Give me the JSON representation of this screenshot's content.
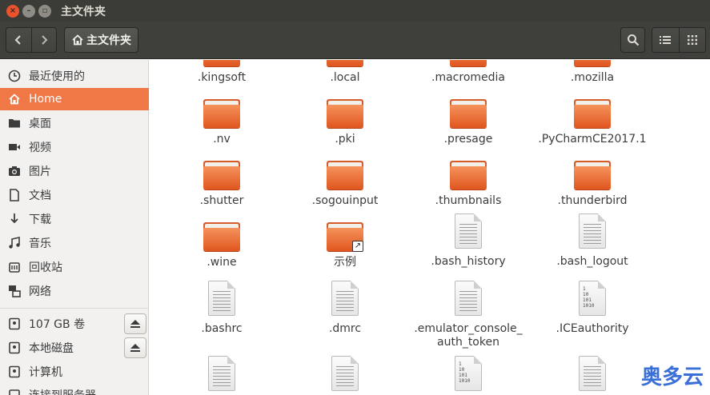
{
  "window": {
    "title": "主文件夹"
  },
  "header": {
    "path_label": "主文件夹",
    "back_icon": "chevron-left-icon",
    "forward_icon": "chevron-right-icon",
    "search_icon": "search-icon",
    "list_view_icon": "list-view-icon",
    "grid_view_icon": "grid-view-icon"
  },
  "sidebar": {
    "items": [
      {
        "label": "最近使用的",
        "icon": "clock-icon"
      },
      {
        "label": "Home",
        "icon": "home-icon"
      },
      {
        "label": "桌面",
        "icon": "folder-icon"
      },
      {
        "label": "视频",
        "icon": "video-icon"
      },
      {
        "label": "图片",
        "icon": "camera-icon"
      },
      {
        "label": "文档",
        "icon": "document-icon"
      },
      {
        "label": "下载",
        "icon": "download-icon"
      },
      {
        "label": "音乐",
        "icon": "music-icon"
      },
      {
        "label": "回收站",
        "icon": "trash-icon"
      },
      {
        "label": "网络",
        "icon": "network-icon"
      }
    ],
    "devices": [
      {
        "label": "107 GB 卷",
        "icon": "drive-icon",
        "eject": true
      },
      {
        "label": "本地磁盘",
        "icon": "drive-icon",
        "eject": true
      },
      {
        "label": "计算机",
        "icon": "drive-icon",
        "eject": false
      },
      {
        "label": "连接到服务器",
        "icon": "server-icon",
        "eject": false
      }
    ]
  },
  "files": {
    "row0": [
      ".kingsoft",
      ".local",
      ".macromedia",
      ".mozilla"
    ],
    "row1": [
      ".nv",
      ".pki",
      ".presage",
      ".PyCharmCE2017.1"
    ],
    "row2": [
      ".shutter",
      ".sogouinput",
      ".thumbnails",
      ".thunderbird"
    ],
    "row3": [
      ".wine",
      "示例",
      ".bash_history",
      ".bash_logout"
    ],
    "row4": [
      ".bashrc",
      ".dmrc",
      ".emulator_console_",
      ".ICEauthority"
    ],
    "row4_line2": "auth_token",
    "binary_text": "1\n10\n101\n1010"
  },
  "watermark": {
    "text": "奥多云"
  },
  "colors": {
    "accent": "#f07746",
    "titlebar": "#3b3b37",
    "folder": "#e96a33"
  }
}
